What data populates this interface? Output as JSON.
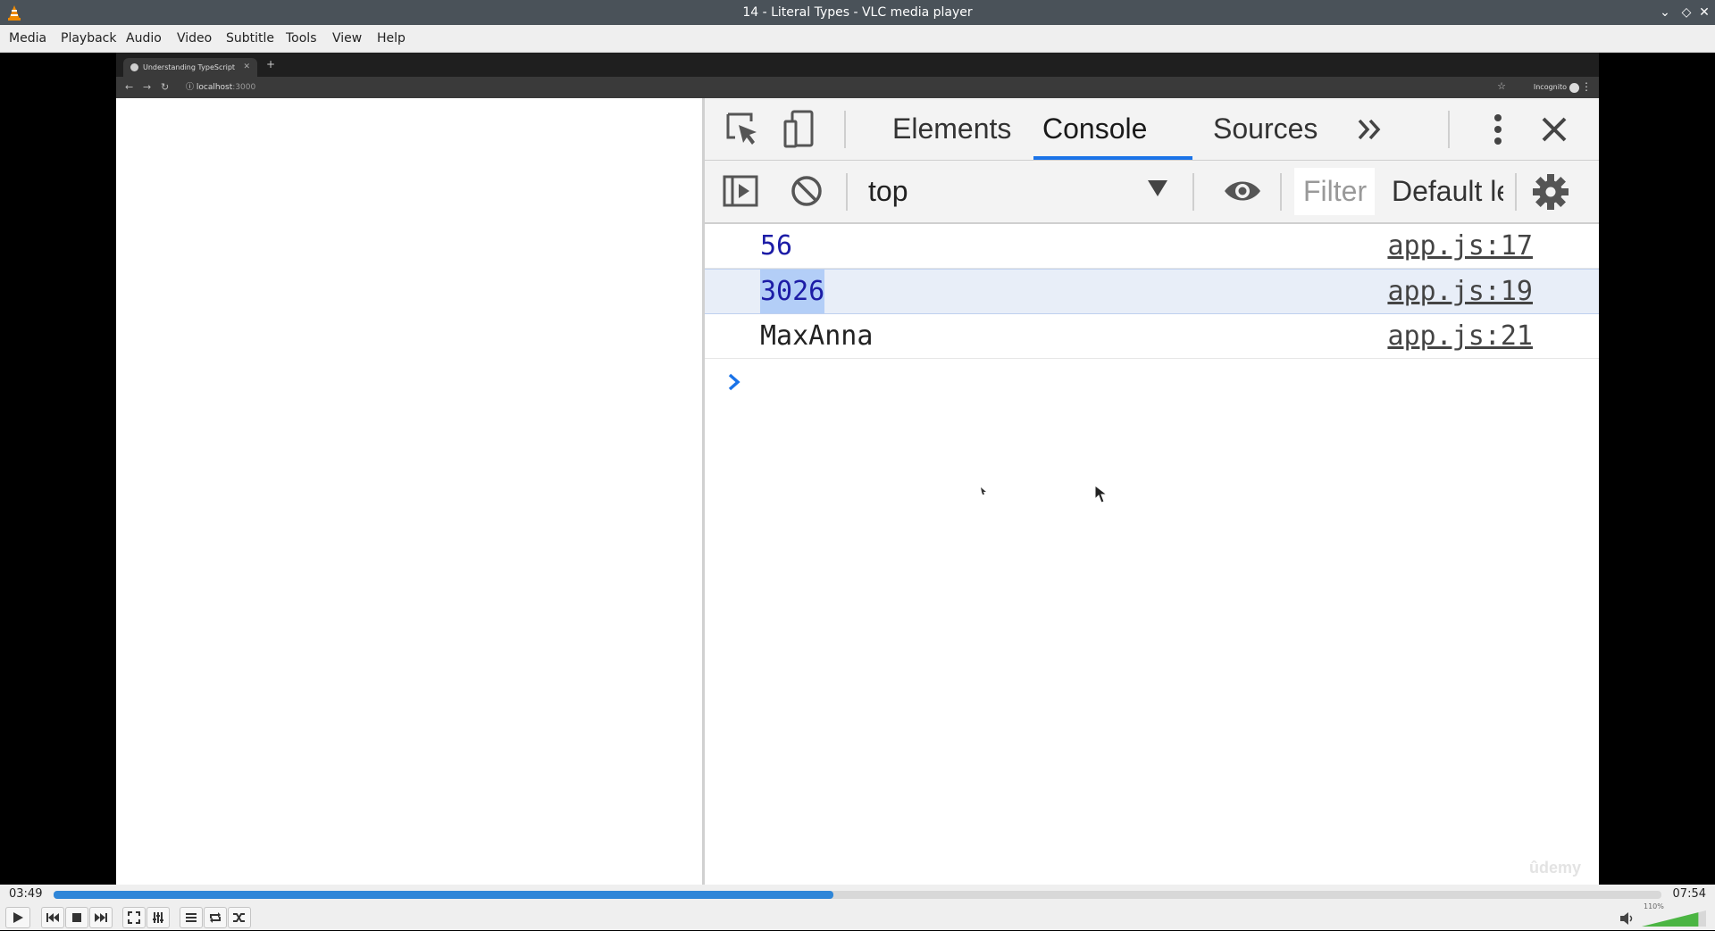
{
  "window": {
    "title": "14 - Literal Types - VLC media player"
  },
  "menu": [
    "Media",
    "Playback",
    "Audio",
    "Video",
    "Subtitle",
    "Tools",
    "View",
    "Help"
  ],
  "browser": {
    "tab_title": "Understanding TypeScript",
    "url_host": "localhost",
    "url_port": ":3000",
    "incognito_label": "Incognito"
  },
  "devtools": {
    "tabs": [
      "Elements",
      "Console",
      "Sources"
    ],
    "active_tab": "Console",
    "context": "top",
    "filter_placeholder": "Filter",
    "levels_label": "Default levels",
    "console_rows": [
      {
        "value": "56",
        "kind": "number",
        "source": "app.js:17"
      },
      {
        "value": "3026",
        "kind": "number",
        "source": "app.js:19",
        "selected": true
      },
      {
        "value": "MaxAnna",
        "kind": "string",
        "source": "app.js:21"
      }
    ],
    "prompt": ">"
  },
  "watermark": "ûdemy",
  "player": {
    "elapsed": "03:49",
    "total": "07:54",
    "progress": 0.485,
    "volume_label": "110%",
    "volume": 1.1
  },
  "colors": {
    "accent": "#1a73e8",
    "seek": "#2f86d8",
    "console_number": "#1c1ca6"
  }
}
